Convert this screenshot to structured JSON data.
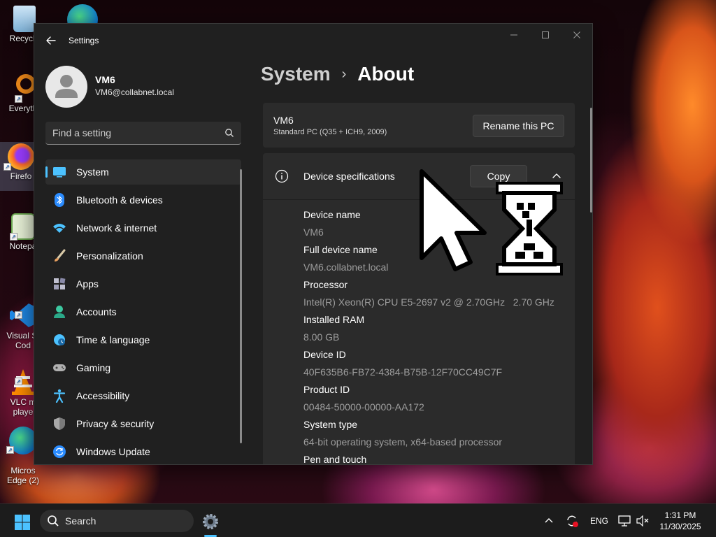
{
  "desktop": {
    "icons": [
      {
        "label": "Recycle",
        "icon": "recycle-bin-icon"
      },
      {
        "label": "Everyth",
        "icon": "everything-search-icon"
      },
      {
        "label": "Firefo",
        "icon": "firefox-icon"
      },
      {
        "label": "Notepa",
        "icon": "notepad-icon"
      },
      {
        "label": "Visual St\nCod",
        "icon": "vscode-icon"
      },
      {
        "label": "VLC m\nplaye",
        "icon": "vlc-icon"
      },
      {
        "label": "Micros\nEdge (2)",
        "icon": "edge-icon"
      }
    ]
  },
  "window": {
    "app_title": "Settings",
    "controls": [
      "minimize",
      "maximize",
      "close"
    ]
  },
  "profile": {
    "name": "VM6",
    "email": "VM6@collabnet.local"
  },
  "search": {
    "placeholder": "Find a setting"
  },
  "sidebar": {
    "items": [
      {
        "label": "System",
        "icon": "system-monitor-icon",
        "active": true,
        "color": "#4cc2ff"
      },
      {
        "label": "Bluetooth & devices",
        "icon": "bluetooth-icon",
        "active": false,
        "color": "#2b8cff"
      },
      {
        "label": "Network & internet",
        "icon": "wifi-icon",
        "active": false,
        "color": "#4cc2ff"
      },
      {
        "label": "Personalization",
        "icon": "paintbrush-icon",
        "active": false,
        "color": "#e8a060"
      },
      {
        "label": "Apps",
        "icon": "apps-icon",
        "active": false,
        "color": "#a0a0c0"
      },
      {
        "label": "Accounts",
        "icon": "person-icon",
        "active": false,
        "color": "#3cc8a0"
      },
      {
        "label": "Time & language",
        "icon": "globe-clock-icon",
        "active": false,
        "color": "#4cc2ff"
      },
      {
        "label": "Gaming",
        "icon": "gamepad-icon",
        "active": false,
        "color": "#b0b0b0"
      },
      {
        "label": "Accessibility",
        "icon": "accessibility-icon",
        "active": false,
        "color": "#4cc2ff"
      },
      {
        "label": "Privacy & security",
        "icon": "shield-icon",
        "active": false,
        "color": "#a0a0a0"
      },
      {
        "label": "Windows Update",
        "icon": "update-icon",
        "active": false,
        "color": "#2b8cff"
      }
    ]
  },
  "breadcrumb": {
    "parent": "System",
    "separator": "›",
    "current": "About"
  },
  "pc_card": {
    "name": "VM6",
    "model": "Standard PC (Q35 + ICH9, 2009)",
    "rename_label": "Rename this PC"
  },
  "specs": {
    "title": "Device specifications",
    "copy_label": "Copy",
    "rows": [
      {
        "label": "Device name",
        "value": "VM6"
      },
      {
        "label": "Full device name",
        "value": "VM6.collabnet.local"
      },
      {
        "label": "Processor",
        "value": "Intel(R) Xeon(R) CPU E5-2697 v2 @ 2.70GHz   2.70 GHz"
      },
      {
        "label": "Installed RAM",
        "value": "8.00 GB"
      },
      {
        "label": "Device ID",
        "value": "40F635B6-FB72-4384-B75B-12F70CC49C7F"
      },
      {
        "label": "Product ID",
        "value": "00484-50000-00000-AA172"
      },
      {
        "label": "System type",
        "value": "64-bit operating system, x64-based processor"
      },
      {
        "label": "Pen and touch",
        "value": ""
      }
    ]
  },
  "taskbar": {
    "search_label": "Search",
    "language": "ENG",
    "time": "1:31 PM",
    "date": "11/30/2025"
  },
  "colors": {
    "accent": "#4cc2ff",
    "window_bg": "#202020",
    "card_bg": "#2b2b2b"
  }
}
